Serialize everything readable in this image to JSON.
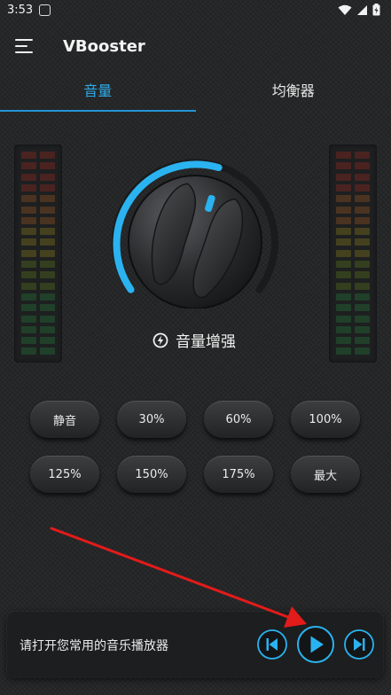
{
  "status_bar": {
    "time": "3:53"
  },
  "app": {
    "title": "VBooster"
  },
  "tabs": [
    {
      "label": "音量",
      "active": true
    },
    {
      "label": "均衡器",
      "active": false
    }
  ],
  "boost": {
    "label": "音量增强"
  },
  "presets": [
    "静音",
    "30%",
    "60%",
    "100%",
    "125%",
    "150%",
    "175%",
    "最大"
  ],
  "player": {
    "prompt": "请打开您常用的音乐播放器"
  },
  "colors": {
    "accent": "#2ea9e6",
    "arrow": "#e21b1b",
    "background": "#232425"
  }
}
